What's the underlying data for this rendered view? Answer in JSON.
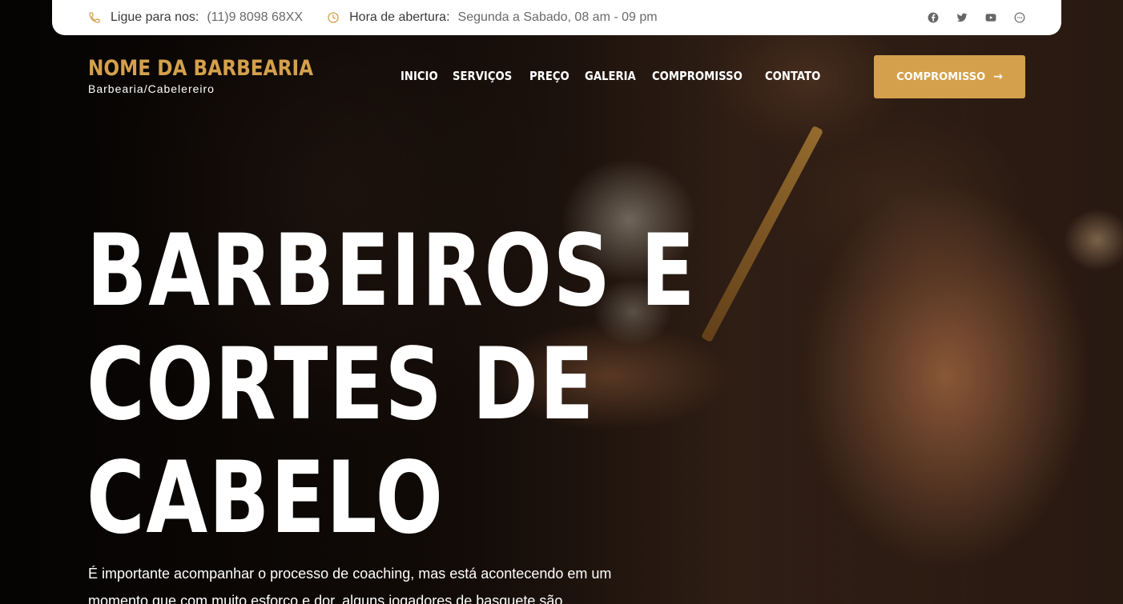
{
  "topbar": {
    "phone_label": "Ligue para nos:",
    "phone_value": "(11)9 8098 68XX",
    "hours_label": "Hora de abertura:",
    "hours_value": "Segunda a Sabado, 08 am - 09 pm",
    "socials": [
      "facebook-icon",
      "twitter-icon",
      "youtube-icon",
      "chat-icon"
    ]
  },
  "brand": {
    "name": "NOME DA BARBEARIA",
    "subtitle": "Barbearia/Cabelereiro"
  },
  "nav": {
    "items": [
      {
        "label": "INICIO"
      },
      {
        "label": "SERVIÇOS"
      },
      {
        "label": "PREÇO"
      },
      {
        "label": "GALERIA"
      },
      {
        "label": "COMPROMISSO"
      },
      {
        "label": "CONTATO"
      }
    ]
  },
  "cta": {
    "label": "COMPROMISSO",
    "arrow": "→"
  },
  "hero": {
    "title_lines": [
      "BARBEIROS E",
      "CORTES DE",
      "CABELO"
    ],
    "text": "É importante acompanhar o processo de coaching, mas está acontecendo em um momento que com muito esforço e dor, alguns jogadores de basquete são"
  },
  "colors": {
    "accent": "#d4a04c",
    "topbar_bg": "#ffffff",
    "text_light": "#ffffff"
  }
}
